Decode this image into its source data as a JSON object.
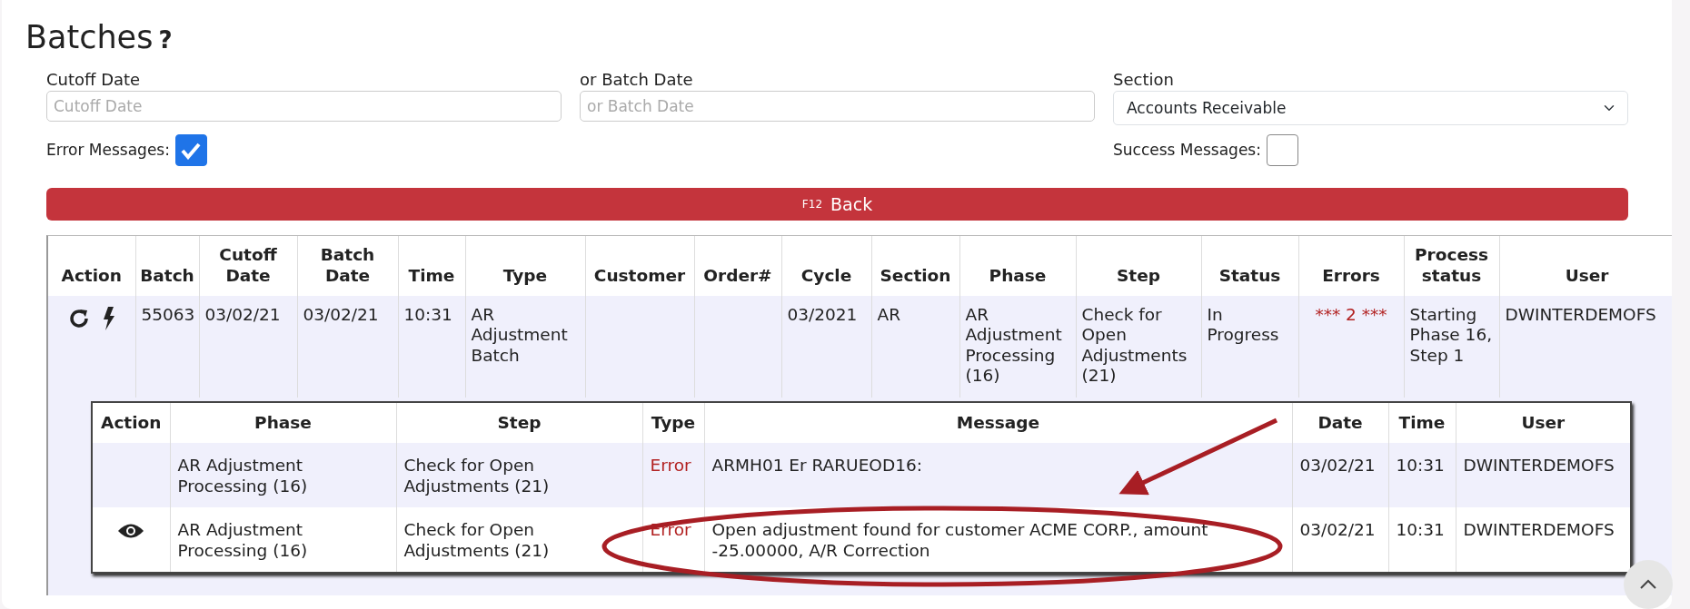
{
  "page": {
    "title": "Batches",
    "help": "?"
  },
  "filters": {
    "cutoff_date": {
      "label": "Cutoff Date",
      "placeholder": "Cutoff Date"
    },
    "batch_date": {
      "label": "or Batch Date",
      "placeholder": "or Batch Date"
    },
    "section": {
      "label": "Section",
      "value": "Accounts Receivable"
    },
    "error_messages": {
      "label": "Error Messages:",
      "checked": true
    },
    "success_messages": {
      "label": "Success Messages:",
      "checked": false
    }
  },
  "back_button": {
    "key": "F12",
    "label": "Back"
  },
  "batches": {
    "columns": [
      "Action",
      "Batch",
      "Cutoff Date",
      "Batch Date",
      "Time",
      "Type",
      "Customer",
      "Order#",
      "Cycle",
      "Section",
      "Phase",
      "Step",
      "Status",
      "Errors",
      "Process status",
      "User"
    ],
    "rows": [
      {
        "batch": "55063",
        "cutoff_date": "03/02/21",
        "batch_date": "03/02/21",
        "time": "10:31",
        "type": "AR Adjustment Batch",
        "customer": "",
        "order": "",
        "cycle": "03/2021",
        "section": "AR",
        "phase": "AR Adjustment Processing (16)",
        "step": "Check for Open Adjustments (21)",
        "status": "In Progress",
        "errors": "*** 2 ***",
        "process_status": "Starting Phase 16, Step 1",
        "user": "DWINTERDEMOFS",
        "messages": {
          "columns": [
            "Action",
            "Phase",
            "Step",
            "Type",
            "Message",
            "Date",
            "Time",
            "User"
          ],
          "rows": [
            {
              "viewable": false,
              "phase": "AR Adjustment Processing (16)",
              "step": "Check for Open Adjustments (21)",
              "type": "Error",
              "message": "ARMH01 Er RARUEOD16:",
              "date": "03/02/21",
              "time": "10:31",
              "user": "DWINTERDEMOFS"
            },
            {
              "viewable": true,
              "phase": "AR Adjustment Processing (16)",
              "step": "Check for Open Adjustments (21)",
              "type": "Error",
              "message": "Open adjustment found for customer ACME CORP., amount -25.00000, A/R Correction",
              "date": "03/02/21",
              "time": "10:31",
              "user": "DWINTERDEMOFS"
            }
          ]
        }
      }
    ]
  }
}
